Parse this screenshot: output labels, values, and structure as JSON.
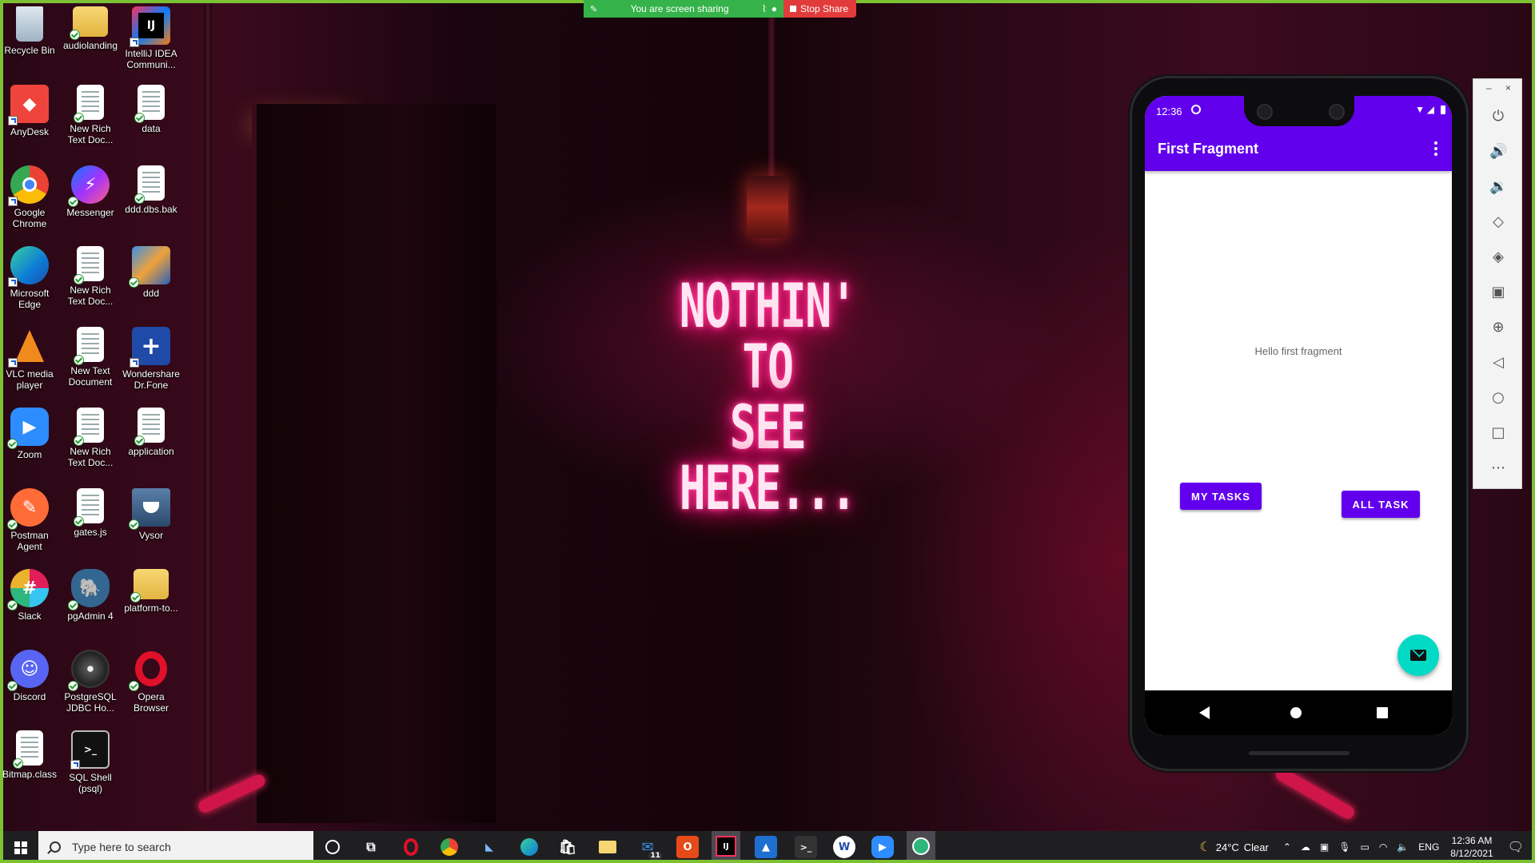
{
  "share_bar": {
    "status_text": "You are screen sharing",
    "stop_label": "Stop Share"
  },
  "desktop_icons": [
    {
      "label": "Recycle Bin"
    },
    {
      "label": "audiolanding"
    },
    {
      "label": "IntelliJ IDEA Communi..."
    },
    {
      "label": "AnyDesk"
    },
    {
      "label": "New Rich Text Doc..."
    },
    {
      "label": "data"
    },
    {
      "label": "Google Chrome"
    },
    {
      "label": "Messenger"
    },
    {
      "label": "ddd.dbs.bak"
    },
    {
      "label": "Microsoft Edge"
    },
    {
      "label": "New Rich Text Doc..."
    },
    {
      "label": "ddd"
    },
    {
      "label": "VLC media player"
    },
    {
      "label": "New Text Document"
    },
    {
      "label": "Wondershare Dr.Fone"
    },
    {
      "label": "Zoom"
    },
    {
      "label": "New Rich Text Doc..."
    },
    {
      "label": "application"
    },
    {
      "label": "Postman Agent"
    },
    {
      "label": "gates.js"
    },
    {
      "label": "Vysor"
    },
    {
      "label": "Slack"
    },
    {
      "label": "pgAdmin 4"
    },
    {
      "label": "platform-to..."
    },
    {
      "label": "Discord"
    },
    {
      "label": "PostgreSQL JDBC Ho..."
    },
    {
      "label": "Opera Browser"
    },
    {
      "label": "Bitmap.class"
    },
    {
      "label": "SQL Shell (psql)"
    }
  ],
  "wallpaper": {
    "neon_line1": "NOTHIN' TO",
    "neon_line2": "SEE HERE..."
  },
  "emulator": {
    "status_time": "12:36",
    "app_title": "First Fragment",
    "hello_text": "Hello first fragment",
    "button_my_tasks": "MY TASKS",
    "button_all_task": "ALL TASK",
    "window_minimize": "–",
    "window_close": "×"
  },
  "taskbar": {
    "search_placeholder": "Type here to search",
    "weather_temp": "24°C",
    "weather_desc": "Clear",
    "language": "ENG",
    "time": "12:36 AM",
    "date": "8/12/2021",
    "mail_badge": "11"
  },
  "colors": {
    "app_primary": "#6200ee",
    "fab": "#03dac5",
    "share_green": "#35b34a",
    "stop_red": "#e23b3b"
  }
}
